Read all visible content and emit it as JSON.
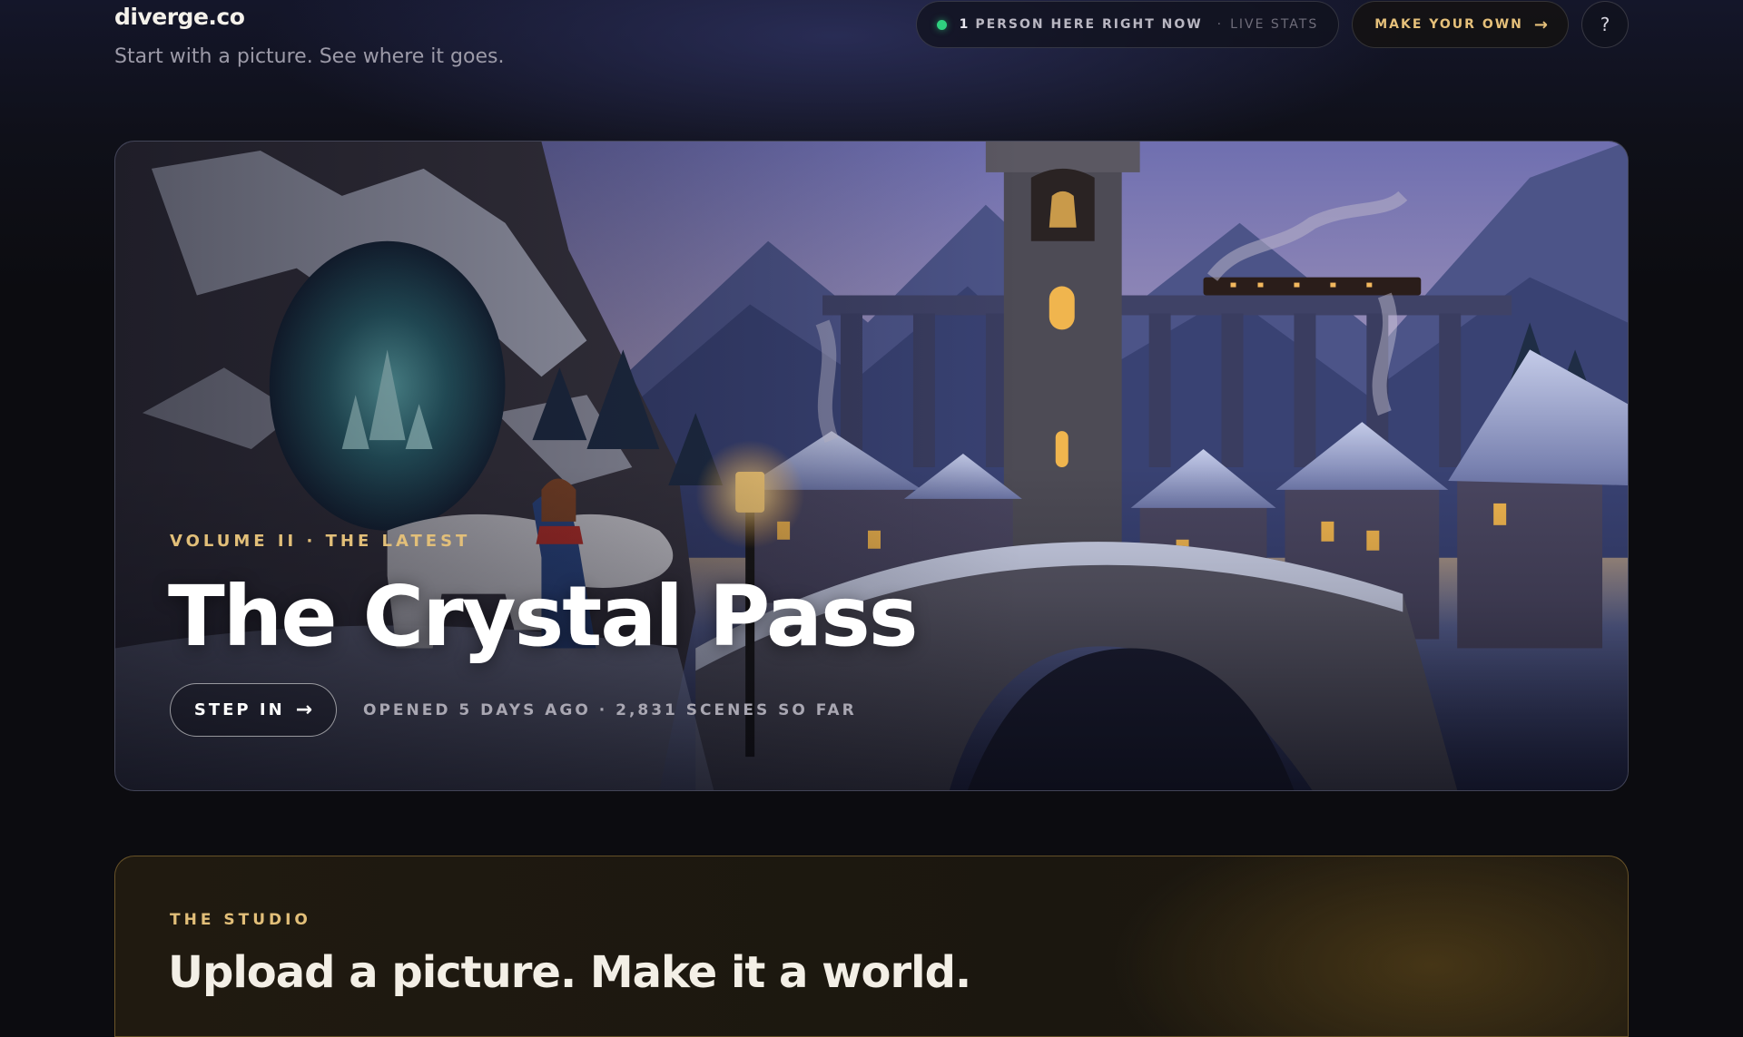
{
  "header": {
    "logo": "diverge.co",
    "tagline": "Start with a picture. See where it goes.",
    "live": {
      "count": "1",
      "label": "PERSON HERE RIGHT NOW",
      "separator": "·",
      "stats_link": "LIVE STATS"
    },
    "make_your_own": "MAKE YOUR OWN",
    "make_arrow": "→",
    "help": "?"
  },
  "hero": {
    "eyebrow": "VOLUME II · THE LATEST",
    "title": "The Crystal Pass",
    "step_in": "STEP IN",
    "step_arrow": "→",
    "meta": "OPENED 5 DAYS AGO · 2,831 SCENES SO FAR"
  },
  "studio": {
    "eyebrow": "THE STUDIO",
    "title": "Upload a picture. Make it a world."
  },
  "colors": {
    "accent_gold": "#e2bf79",
    "live_green": "#2fd07f",
    "background": "#0c0c10"
  }
}
